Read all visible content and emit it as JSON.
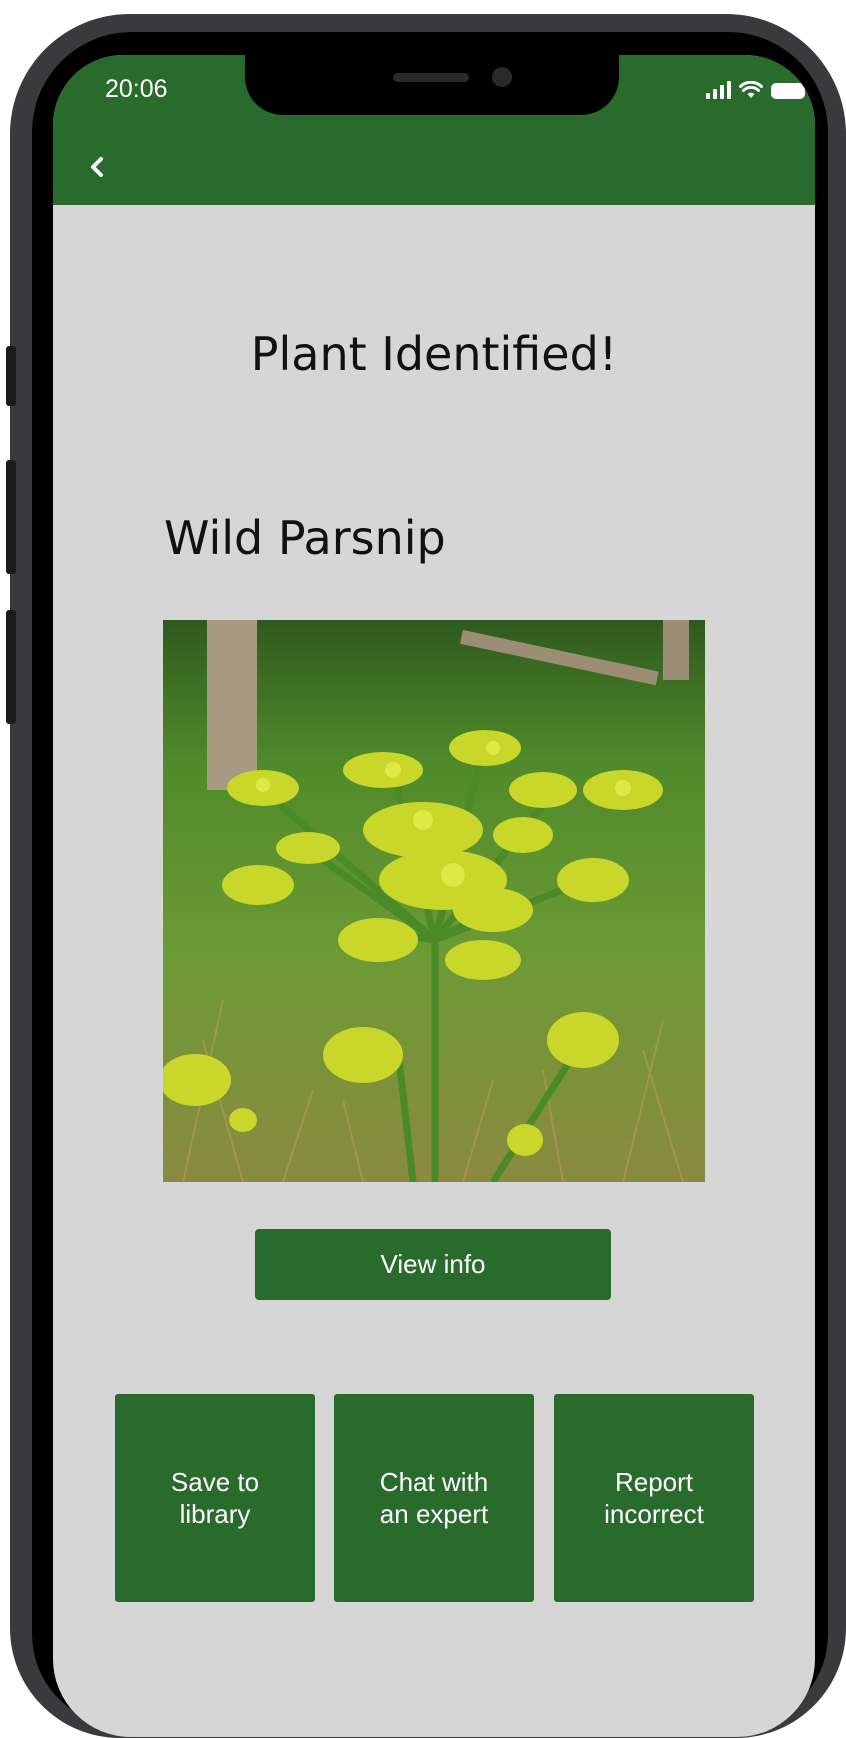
{
  "status_bar": {
    "time": "20:06",
    "icons": [
      "signal-icon",
      "wifi-icon",
      "battery-icon"
    ]
  },
  "app_bar": {
    "back_icon": "chevron-left-icon",
    "color": "#286b2d"
  },
  "main": {
    "title": "Plant Identified!",
    "plant_name": "Wild Parsnip",
    "photo_description": "wild-parsnip-flower-photo"
  },
  "buttons": {
    "view_info": "View info",
    "save": "Save to\nlibrary",
    "chat": "Chat with\nan expert",
    "report": "Report\nincorrect"
  },
  "colors": {
    "accent": "#286b2d",
    "background": "#d7d6d6"
  }
}
